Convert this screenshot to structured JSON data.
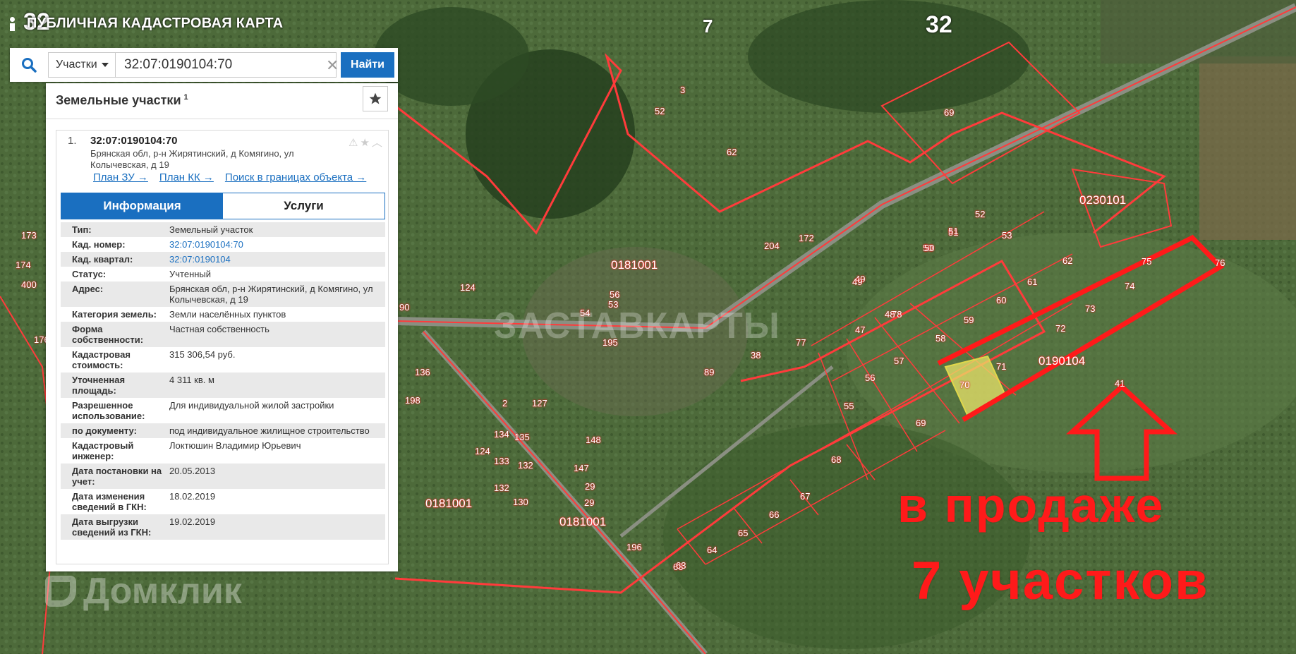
{
  "app_title": "ПУБЛИЧНАЯ КАДАСТРОВАЯ КАРТА",
  "search": {
    "type_value": "Участки",
    "query": "32:07:0190104:70",
    "find_label": "Найти"
  },
  "panel": {
    "title": "Земельные участки",
    "count": "1",
    "result": {
      "index": "1.",
      "cadastral_number": "32:07:0190104:70",
      "address": "Брянская обл, р-н Жирятинский, д Комягино, ул Колычевская, д 19",
      "links": [
        "План ЗУ →",
        "План КК →",
        "Поиск в границах объекта →"
      ]
    },
    "tabs": [
      "Информация",
      "Услуги"
    ],
    "attributes": [
      {
        "label": "Тип:",
        "value": "Земельный участок"
      },
      {
        "label": "Кад. номер:",
        "value": "32:07:0190104:70"
      },
      {
        "label": "Кад. квартал:",
        "value": "32:07:0190104"
      },
      {
        "label": "Статус:",
        "value": "Учтенный"
      },
      {
        "label": "Адрес:",
        "value": "Брянская обл, р-н Жирятинский, д Комягино, ул Колычевская, д 19"
      },
      {
        "label": "Категория земель:",
        "value": "Земли населённых пунктов"
      },
      {
        "label": "Форма собственности:",
        "value": "Частная собственность"
      },
      {
        "label": "Кадастровая стоимость:",
        "value": "315 306,54 руб."
      },
      {
        "label": "Уточненная площадь:",
        "value": "4 311 кв. м"
      },
      {
        "label": "Разрешенное использование:",
        "value": "Для индивидуальной жилой застройки"
      },
      {
        "label": "по документу:",
        "value": "под индивидуальное жилищное строительство"
      },
      {
        "label": "Кадастровый инженер:",
        "value": "Локтюшин Владимир Юрьевич"
      },
      {
        "label": "Дата постановки на учет:",
        "value": "20.05.2013"
      },
      {
        "label": "Дата изменения сведений в ГКН:",
        "value": "18.02.2019"
      },
      {
        "label": "Дата выгрузки сведений из ГКН:",
        "value": "19.02.2019"
      }
    ]
  },
  "map": {
    "quarter_labels": [
      "0181001",
      "0181001",
      "0181001",
      "0230101",
      "0190104"
    ],
    "top_labels": [
      "32",
      "7",
      "32"
    ],
    "parcel_labels": [
      "69",
      "3",
      "52",
      "62",
      "51",
      "50",
      "49",
      "48",
      "47",
      "53",
      "52",
      "51",
      "50",
      "49",
      "78",
      "77",
      "57",
      "56",
      "55",
      "60",
      "59",
      "58",
      "61",
      "62",
      "63",
      "64",
      "65",
      "66",
      "67",
      "68",
      "69",
      "70",
      "71",
      "72",
      "73",
      "74",
      "75",
      "76",
      "124",
      "173",
      "174",
      "400",
      "176",
      "90",
      "195",
      "136",
      "198",
      "54",
      "53",
      "56",
      "38",
      "89",
      "2",
      "127",
      "134",
      "135",
      "133",
      "132",
      "132",
      "130",
      "124",
      "148",
      "147",
      "29",
      "29",
      "196",
      "63",
      "204",
      "172",
      "41"
    ]
  },
  "annotation": {
    "line1": "в продаже",
    "line2": "7 участков"
  },
  "watermarks": [
    "Домклик",
    "ЗАСТАВКАРТЫ"
  ],
  "colors": {
    "accent": "#1a6fc0",
    "parcel_border": "#ff2a2a",
    "annotation": "#ff1a1a",
    "selected_parcel": "#e9e36a"
  }
}
